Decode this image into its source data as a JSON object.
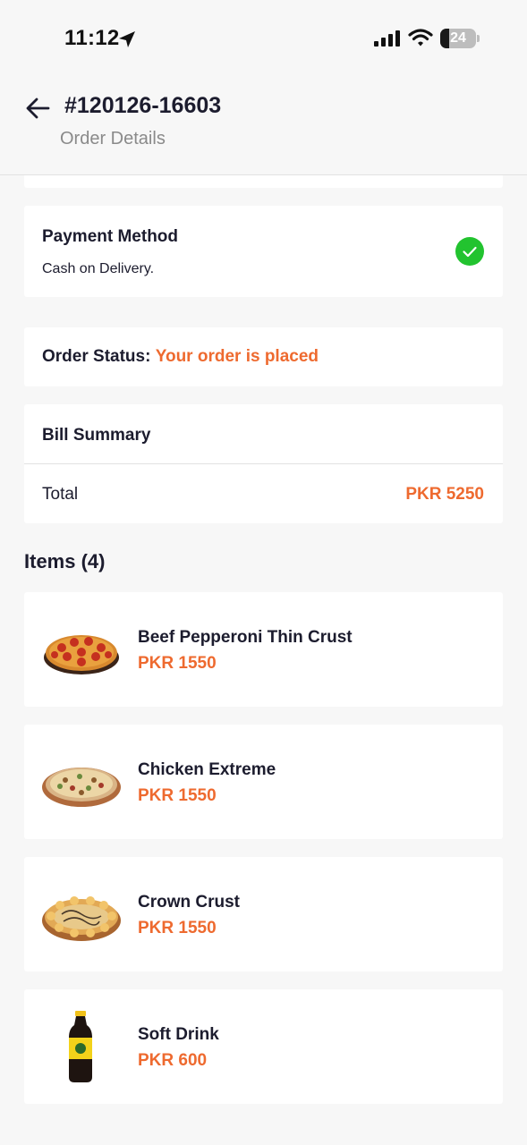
{
  "status_bar": {
    "time": "11:12",
    "battery": "24",
    "battery_level": 0.24
  },
  "header": {
    "order_id": "#120126-16603",
    "subtitle": "Order Details",
    "back_icon": "arrow-left-icon"
  },
  "payment": {
    "title": "Payment Method",
    "value": "Cash on Delivery.",
    "icon": "check-circle-icon"
  },
  "order_status": {
    "label": "Order Status:",
    "value": "Your order is placed"
  },
  "bill": {
    "title": "Bill Summary",
    "total_label": "Total",
    "total_value": "PKR 5250"
  },
  "items": {
    "heading": "Items (4)",
    "list": [
      {
        "name": "Beef Pepperoni Thin Crust",
        "price": "PKR 1550",
        "icon": "pepperoni-pizza-image"
      },
      {
        "name": "Chicken Extreme",
        "price": "PKR 1550",
        "icon": "chicken-pizza-image"
      },
      {
        "name": "Crown Crust",
        "price": "PKR 1550",
        "icon": "crown-crust-pizza-image"
      },
      {
        "name": "Soft Drink",
        "price": "PKR 600",
        "icon": "soft-drink-bottle-image"
      }
    ]
  },
  "colors": {
    "accent": "#ee6a2f",
    "success": "#22c32f",
    "background": "#f7f7f7",
    "card": "#ffffff",
    "text": "#1c1c2e",
    "muted": "#8a8a8a"
  }
}
